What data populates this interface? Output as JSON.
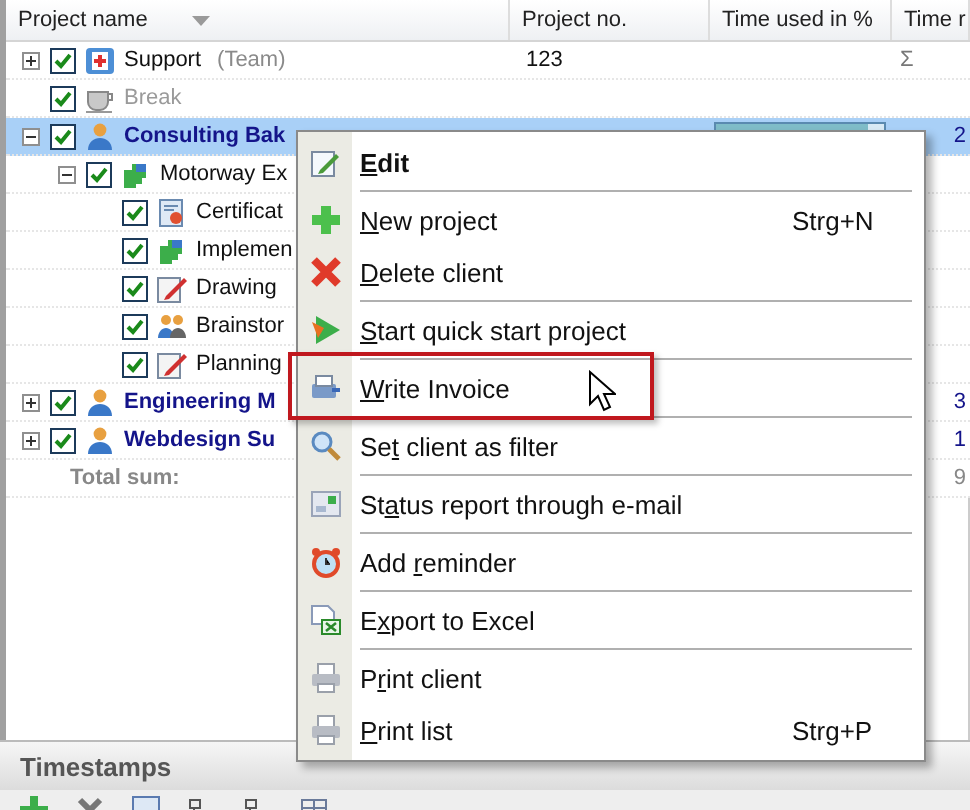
{
  "table": {
    "columns": [
      "Project name",
      "Project no.",
      "Time used in %",
      "Time r"
    ],
    "rows": [
      {
        "kind": "team",
        "name": "Support",
        "suffix": "(Team)",
        "checked": true,
        "expanded": false,
        "selected": false,
        "project_no": "123",
        "sigma": "Σ"
      },
      {
        "kind": "break",
        "name": "Break",
        "checked": true,
        "selected": false
      },
      {
        "kind": "client",
        "name": "Consulting Bak",
        "checked": true,
        "expanded": true,
        "selected": true,
        "level": 0.9,
        "time_r": "2",
        "children": [
          {
            "kind": "project",
            "name": "Motorway Ex",
            "checked": true,
            "expanded": true,
            "selected": false,
            "children": [
              {
                "kind": "task",
                "name": "Certificat",
                "checked": true,
                "selected": false
              },
              {
                "kind": "task",
                "name": "Implemen",
                "checked": true,
                "selected": false
              },
              {
                "kind": "task",
                "name": "Drawing",
                "checked": true,
                "selected": false
              },
              {
                "kind": "task",
                "name": "Brainstor",
                "checked": true,
                "selected": false
              },
              {
                "kind": "task",
                "name": "Planning",
                "checked": true,
                "selected": false
              }
            ]
          }
        ]
      },
      {
        "kind": "client",
        "name": "Engineering M",
        "checked": true,
        "expanded": false,
        "selected": false,
        "time_r": "3"
      },
      {
        "kind": "client",
        "name": "Webdesign Su",
        "checked": true,
        "expanded": false,
        "selected": false,
        "time_r": "1"
      }
    ],
    "total": {
      "label": "Total sum:",
      "time_r": "9"
    }
  },
  "context_menu": {
    "items": [
      {
        "key": "E",
        "post": "dit",
        "default": true,
        "highlighted": false
      },
      {
        "key": "N",
        "post": "ew project",
        "shortcut": "Strg+N",
        "default": false,
        "highlighted": false
      },
      {
        "key": "D",
        "post": "elete client",
        "default": false,
        "highlighted": false
      },
      {
        "key": "S",
        "post": "tart quick start project",
        "default": false,
        "highlighted": false
      },
      {
        "key": "W",
        "post": "rite Invoice",
        "default": false,
        "highlighted": true
      },
      {
        "pre": "Se",
        "key": "t",
        "post": " client as filter",
        "default": false,
        "highlighted": false
      },
      {
        "pre": "St",
        "key": "a",
        "post": "tus report through e-mail",
        "default": false,
        "highlighted": false
      },
      {
        "pre": "Add ",
        "key": "r",
        "post": "eminder",
        "default": false,
        "highlighted": false
      },
      {
        "pre": "E",
        "key": "x",
        "post": "port to Excel",
        "default": false,
        "highlighted": false
      },
      {
        "pre": "P",
        "key": "r",
        "post": "int client",
        "default": false,
        "highlighted": false
      },
      {
        "key": "P",
        "post": "rint list",
        "shortcut": "Strg+P",
        "default": false,
        "highlighted": false
      }
    ]
  },
  "timestamps_panel": {
    "title": "Timestamps"
  }
}
